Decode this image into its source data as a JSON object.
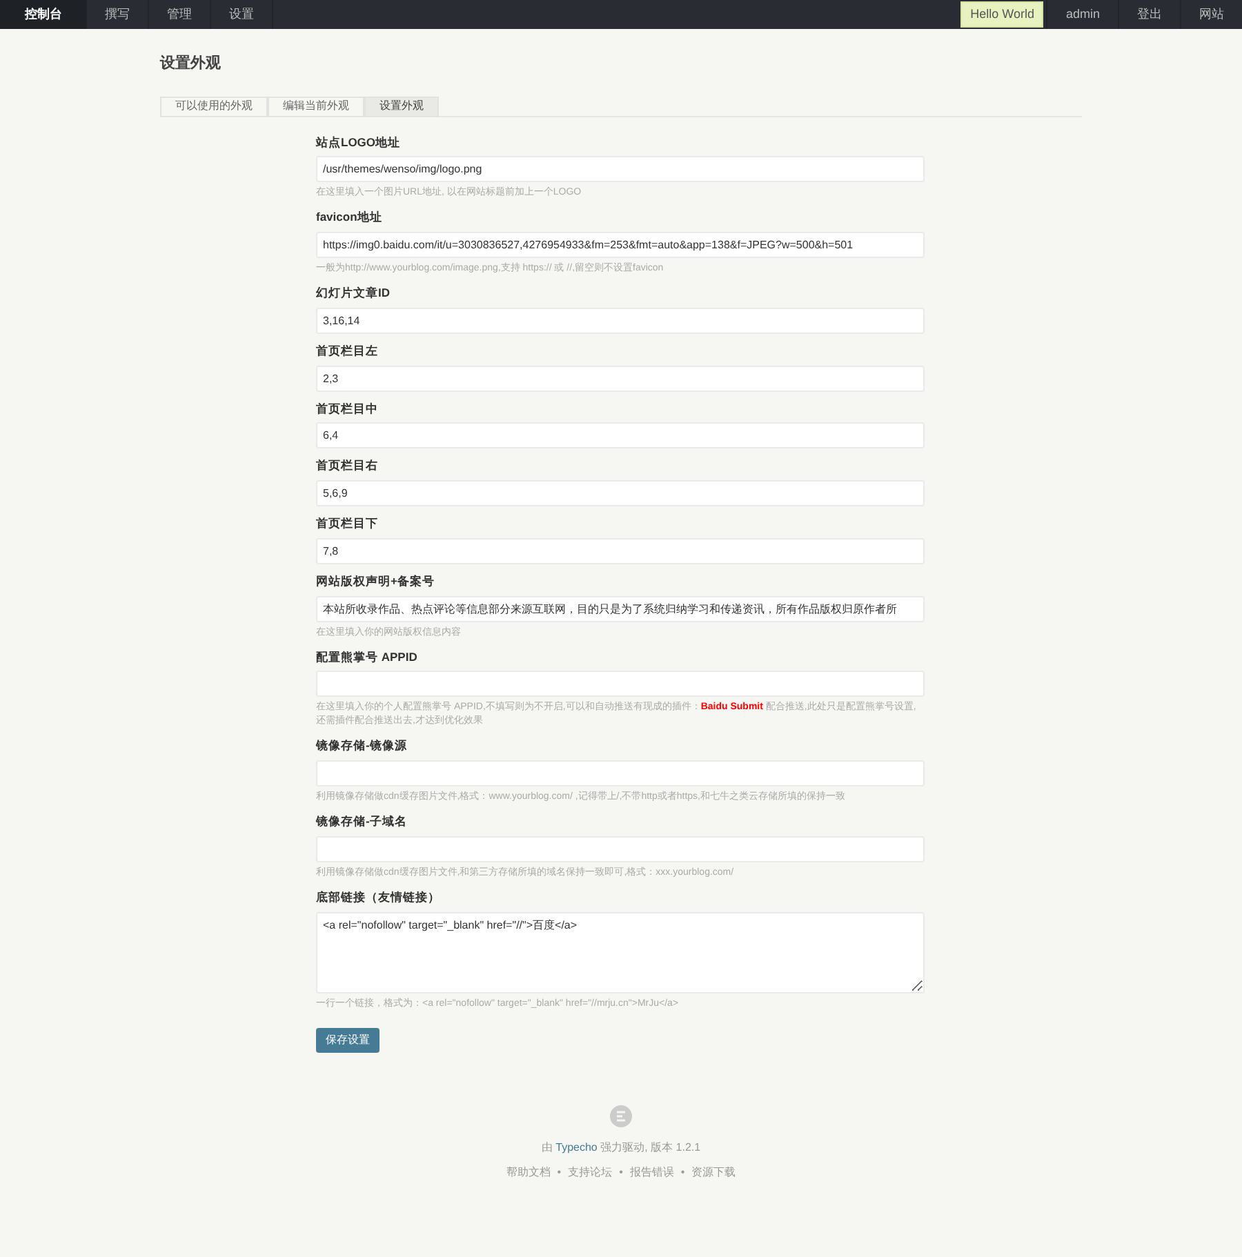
{
  "nav": {
    "left": [
      {
        "label": "控制台",
        "selected": true
      },
      {
        "label": "撰写",
        "selected": false
      },
      {
        "label": "管理",
        "selected": false
      },
      {
        "label": "设置",
        "selected": false
      }
    ],
    "right": [
      {
        "label": "Hello World",
        "kind": "user"
      },
      {
        "label": "admin",
        "kind": "link"
      },
      {
        "label": "登出",
        "kind": "link"
      },
      {
        "label": "网站",
        "kind": "link"
      }
    ]
  },
  "page_title": "设置外观",
  "tabs": [
    {
      "label": "可以使用的外观",
      "selected": false
    },
    {
      "label": "编辑当前外观",
      "selected": false
    },
    {
      "label": "设置外观",
      "selected": true
    }
  ],
  "fields": [
    {
      "kind": "input",
      "label": "站点LOGO地址",
      "value": "/usr/themes/wenso/img/logo.png",
      "hint": "在这里填入一个图片URL地址, 以在网站标题前加上一个LOGO"
    },
    {
      "kind": "input",
      "label": "favicon地址",
      "value": "https://img0.baidu.com/it/u=3030836527,4276954933&fm=253&fmt=auto&app=138&f=JPEG?w=500&h=501",
      "hint": "一般为http://www.yourblog.com/image.png,支持 https:// 或 //,留空则不设置favicon"
    },
    {
      "kind": "input",
      "label": "幻灯片文章ID",
      "value": "3,16,14"
    },
    {
      "kind": "input",
      "label": "首页栏目左",
      "value": "2,3"
    },
    {
      "kind": "input",
      "label": "首页栏目中",
      "value": "6,4"
    },
    {
      "kind": "input",
      "label": "首页栏目右",
      "value": "5,6,9"
    },
    {
      "kind": "input",
      "label": "首页栏目下",
      "value": "7,8"
    },
    {
      "kind": "input",
      "label": "网站版权声明+备案号",
      "value": "本站所收录作品、热点评论等信息部分来源互联网，目的只是为了系统归纳学习和传递资讯，所有作品版权归原作者所",
      "hint": "在这里填入你的网站版权信息内容"
    },
    {
      "kind": "input",
      "label": "配置熊掌号 APPID",
      "hint": "在这里填入你的个人配置熊掌号 APPID,不填写则为不开启,可以和自动推送有现成的插件：**Baidu Submit** 配合推送,此处只是配置熊掌号设置,还需插件配合推送出去,才达到优化效果"
    },
    {
      "kind": "input",
      "label": "镜像存储-镜像源",
      "hint": "利用镜像存储做cdn缓存图片文件,格式：www.yourblog.com/ ,记得带上/,不带http或者https,和七牛之类云存储所填的保持一致"
    },
    {
      "kind": "input",
      "label": "镜像存储-子域名",
      "hint": "利用镜像存储做cdn缓存图片文件,和第三方存储所填的域名保持一致即可,格式：xxx.yourblog.com/"
    },
    {
      "kind": "textarea",
      "label": "底部链接（友情链接）",
      "value": "<a rel=\"nofollow\" target=\"_blank\" href=\"//\">百度</a>",
      "hint": "一行一个链接，格式为：<a rel=\"nofollow\" target=\"_blank\" href=\"//mrju.cn\">MrJu</a>"
    }
  ],
  "save_button": "保存设置",
  "footer": {
    "credit": "由 **Typecho** 强力驱动, 版本 1.2.1",
    "links": [
      "帮助文档",
      "支持论坛",
      "报告错误",
      "资源下载"
    ],
    "separator": "•"
  }
}
